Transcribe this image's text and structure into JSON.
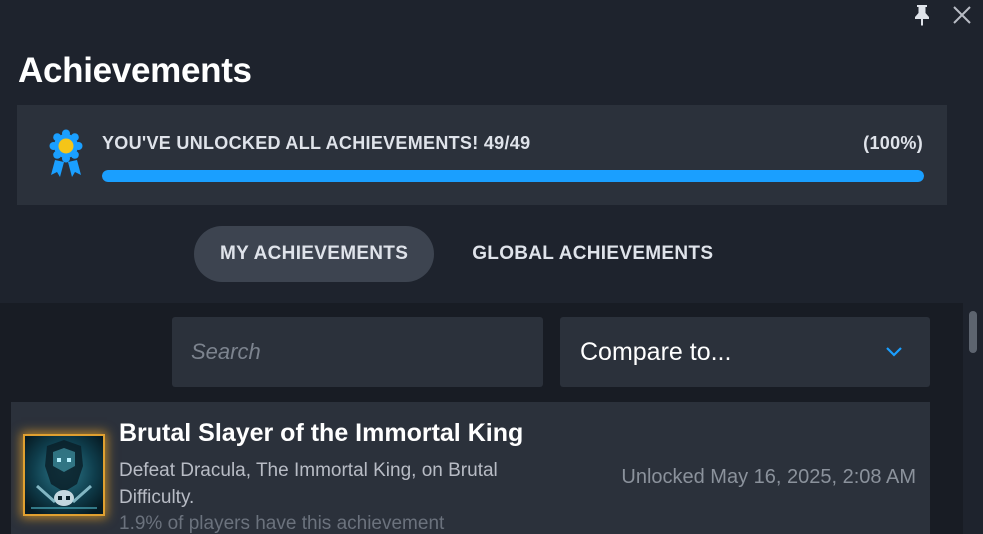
{
  "header": {
    "title": "Achievements"
  },
  "window_controls": {
    "pin_icon": "pin-icon",
    "close_icon": "close-icon"
  },
  "progress": {
    "message": "YOU'VE UNLOCKED ALL ACHIEVEMENTS! 49/49",
    "percent_label": "(100%)",
    "fraction": 1.0,
    "icon": "medal-icon",
    "bar_color": "#1a9fff"
  },
  "tabs": [
    {
      "label": "MY ACHIEVEMENTS",
      "active": true
    },
    {
      "label": "GLOBAL ACHIEVEMENTS",
      "active": false
    }
  ],
  "search": {
    "placeholder": "Search",
    "value": ""
  },
  "compare": {
    "label": "Compare to...",
    "icon": "chevron-down-icon",
    "accent": "#1a9fff"
  },
  "achievements": [
    {
      "name": "Brutal Slayer of the Immortal King",
      "description": "Defeat Dracula, The Immortal King, on Brutal Difficulty.",
      "unlocked": "Unlocked May 16, 2025, 2:08 AM",
      "rarity": "1.9% of players have this achievement",
      "icon": "achievement-badge-icon"
    }
  ]
}
